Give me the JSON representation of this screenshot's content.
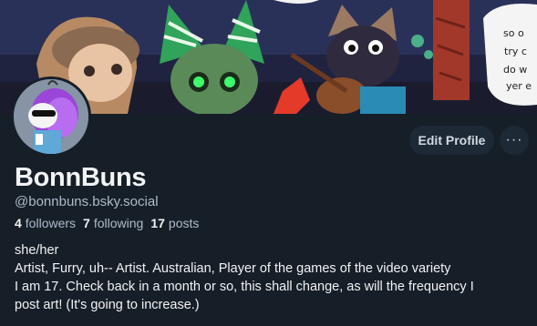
{
  "profile": {
    "display_name": "BonnBuns",
    "handle": "@bonnbuns.bsky.social",
    "stats": {
      "followers_count": "4",
      "followers_label": "followers",
      "following_count": "7",
      "following_label": "following",
      "posts_count": "17",
      "posts_label": "posts"
    },
    "bio_lines": [
      "she/her",
      "Artist, Furry, uh-- Artist. Australian, Player of the games of the video variety",
      "I am 17. Check back in a month or so, this shall change, as will the frequency I",
      "post art! (It's going to increase.)"
    ]
  },
  "actions": {
    "edit_label": "Edit Profile",
    "more_label": "···"
  },
  "banner": {
    "speech_text_lines": [
      "so o",
      "try c",
      "do w",
      "yer e"
    ]
  },
  "icons": {
    "more": "ellipsis-icon"
  },
  "colors": {
    "background": "#161e27",
    "button_bg": "#1e2936",
    "muted_text": "#aebbc9"
  }
}
